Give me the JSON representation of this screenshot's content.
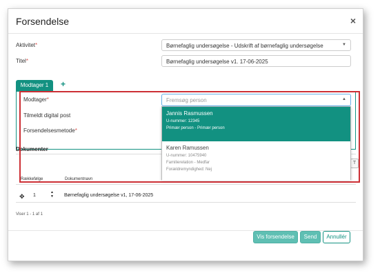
{
  "modal": {
    "title": "Forsendelse",
    "close_label": "×"
  },
  "form": {
    "aktivitet_label": "Aktivitet",
    "aktivitet_value": "Børnefaglig undersøgelse - Udskrift af børnefaglig undersøgelse",
    "titel_label": "Titel",
    "titel_value": "Børnefaglig undersøgelse v1. 17-06-2025",
    "required_mark": "*"
  },
  "tabs": {
    "active_label": "Modtager 1",
    "add_label": "+"
  },
  "recipient": {
    "modtager_label": "Modtager",
    "search_placeholder": "Fremsøg person",
    "digital_post_label": "Tilmeldt digital post",
    "method_label": "Forsendelsesmetode",
    "options": [
      {
        "name": "Jannis Rasmussen",
        "line1": "U-nummer: 12345",
        "line2": "Primær person - Primær person"
      },
      {
        "name": "Karen Ramussen",
        "line1": "U-nummer: 10475940",
        "line2": "Familierelation - Medfar",
        "line3": "Forældremyndighed: Nej"
      }
    ]
  },
  "documents": {
    "section_title": "Dokumenter",
    "col_order": "Rækkefølge",
    "col_name": "Dokumentnavn",
    "rows": [
      {
        "order": "1",
        "name": "Børnefaglig undersøgelse v1, 17-06-2025"
      }
    ],
    "pagination": "Viser 1 - 1 af 1"
  },
  "footer": {
    "vis_label": "Vis forsendelse",
    "send_label": "Send",
    "cancel_label": "Annullér"
  },
  "colors": {
    "accent": "#129181",
    "highlight_border": "#cc2e34"
  }
}
